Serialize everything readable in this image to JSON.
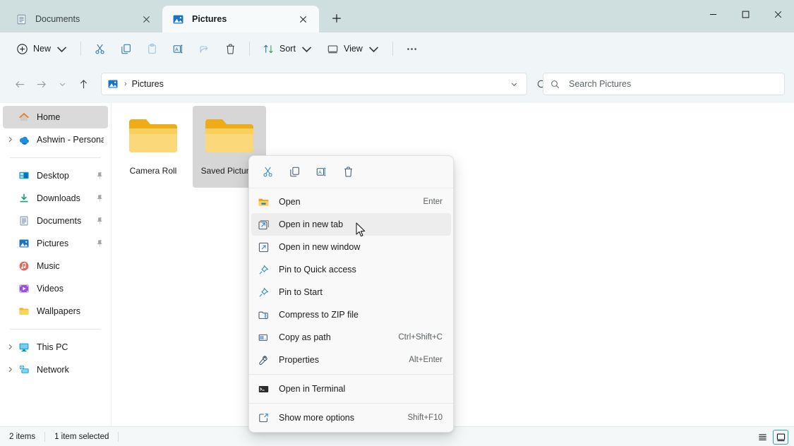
{
  "window": {
    "controls": [
      {
        "name": "minimize",
        "glyph": "minimize-icon"
      },
      {
        "name": "maximize",
        "glyph": "maximize-icon"
      },
      {
        "name": "close",
        "glyph": "close-icon"
      }
    ]
  },
  "tabs": [
    {
      "label": "Documents",
      "icon": "documents-icon",
      "active": false,
      "close_label": "Close tab"
    },
    {
      "label": "Pictures",
      "icon": "pictures-icon",
      "active": true,
      "close_label": "Close tab"
    }
  ],
  "new_tab": {
    "label": "+",
    "tooltip": "Add new tab"
  },
  "toolbar": {
    "new_label": "New",
    "sort_label": "Sort",
    "view_label": "View",
    "more_label": "See more",
    "items": [
      {
        "name": "cut",
        "label": "Cut",
        "disabled": false
      },
      {
        "name": "copy",
        "label": "Copy",
        "disabled": false
      },
      {
        "name": "paste",
        "label": "Paste",
        "disabled": true
      },
      {
        "name": "rename",
        "label": "Rename",
        "disabled": false
      },
      {
        "name": "share",
        "label": "Share",
        "disabled": true
      },
      {
        "name": "delete",
        "label": "Delete",
        "disabled": false
      }
    ]
  },
  "address": {
    "crumb_icon": "pictures-icon",
    "separator": "›",
    "path": "Pictures",
    "dropdown_label": "Previous locations",
    "refresh_label": "Refresh"
  },
  "search": {
    "placeholder": "Search Pictures",
    "value": ""
  },
  "sidebar": {
    "items": [
      {
        "label": "Home",
        "icon": "home-icon",
        "selected": true,
        "chevron": false,
        "pinned": false
      },
      {
        "label": "Ashwin - Personal",
        "icon": "onedrive-icon",
        "selected": false,
        "chevron": true,
        "pinned": false
      },
      {
        "separator": true
      },
      {
        "label": "Desktop",
        "icon": "desktop-icon",
        "selected": false,
        "chevron": false,
        "pinned": true
      },
      {
        "label": "Downloads",
        "icon": "downloads-icon",
        "selected": false,
        "chevron": false,
        "pinned": true
      },
      {
        "label": "Documents",
        "icon": "documents-icon",
        "selected": false,
        "chevron": false,
        "pinned": true
      },
      {
        "label": "Pictures",
        "icon": "pictures-icon",
        "selected": false,
        "chevron": false,
        "pinned": true
      },
      {
        "label": "Music",
        "icon": "music-icon",
        "selected": false,
        "chevron": false,
        "pinned": false
      },
      {
        "label": "Videos",
        "icon": "videos-icon",
        "selected": false,
        "chevron": false,
        "pinned": false
      },
      {
        "label": "Wallpapers",
        "icon": "folder-icon",
        "selected": false,
        "chevron": false,
        "pinned": false
      },
      {
        "separator": true
      },
      {
        "label": "This PC",
        "icon": "thispc-icon",
        "selected": false,
        "chevron": true,
        "pinned": false
      },
      {
        "label": "Network",
        "icon": "network-icon",
        "selected": false,
        "chevron": true,
        "pinned": false
      }
    ]
  },
  "content": {
    "items": [
      {
        "label": "Camera Roll",
        "icon": "folder-icon",
        "selected": false
      },
      {
        "label": "Saved Pictures",
        "icon": "folder-icon",
        "selected": true
      }
    ]
  },
  "context_menu": {
    "header_buttons": [
      {
        "name": "cut",
        "label": "Cut"
      },
      {
        "name": "copy",
        "label": "Copy"
      },
      {
        "name": "rename",
        "label": "Rename"
      },
      {
        "name": "delete",
        "label": "Delete"
      }
    ],
    "items": [
      {
        "label": "Open",
        "accel": "Enter",
        "icon": "folder-icon",
        "hover": false
      },
      {
        "label": "Open in new tab",
        "accel": "",
        "icon": "open-new-tab-icon",
        "hover": true
      },
      {
        "label": "Open in new window",
        "accel": "",
        "icon": "open-new-window-icon",
        "hover": false
      },
      {
        "label": "Pin to Quick access",
        "accel": "",
        "icon": "pin-icon",
        "hover": false
      },
      {
        "label": "Pin to Start",
        "accel": "",
        "icon": "pin-icon",
        "hover": false
      },
      {
        "label": "Compress to ZIP file",
        "accel": "",
        "icon": "zip-icon",
        "hover": false
      },
      {
        "label": "Copy as path",
        "accel": "Ctrl+Shift+C",
        "icon": "copy-path-icon",
        "hover": false
      },
      {
        "label": "Properties",
        "accel": "Alt+Enter",
        "icon": "properties-icon",
        "hover": false
      },
      {
        "separator": true
      },
      {
        "label": "Open in Terminal",
        "accel": "",
        "icon": "terminal-icon",
        "hover": false
      },
      {
        "separator": true
      },
      {
        "label": "Show more options",
        "accel": "Shift+F10",
        "icon": "more-options-icon",
        "hover": false
      }
    ]
  },
  "status": {
    "item_count": "2 items",
    "selection": "1 item selected",
    "views": [
      {
        "name": "details-view",
        "active": false
      },
      {
        "name": "large-icons-view",
        "active": true
      }
    ]
  },
  "colors": {
    "titlebar": "#cfdfe0",
    "toolbar": "#f0f6f7",
    "accent": "#0f6cbd",
    "selection": "#d6d6d6",
    "menu_bg": "#f9f9f9",
    "folder_yellow": "#ffd04a"
  }
}
